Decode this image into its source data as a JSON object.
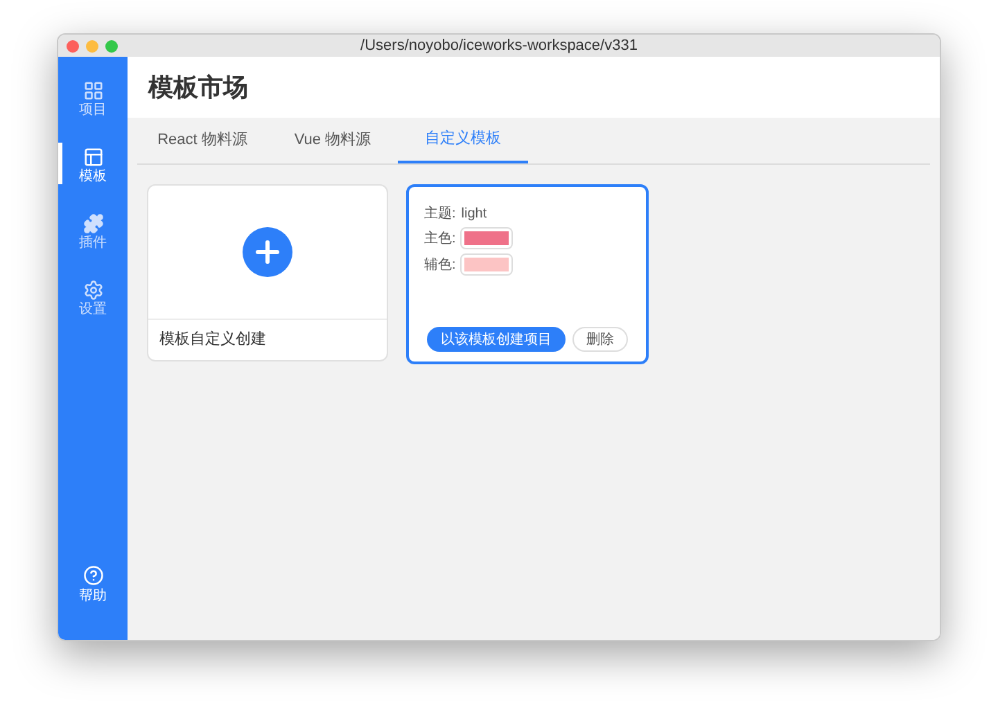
{
  "window": {
    "title": "/Users/noyobo/iceworks-workspace/v331"
  },
  "sidebar": {
    "items": [
      {
        "label": "项目",
        "selected": false
      },
      {
        "label": "模板",
        "selected": true
      },
      {
        "label": "插件",
        "selected": false
      },
      {
        "label": "设置",
        "selected": false
      }
    ],
    "help": {
      "label": "帮助"
    }
  },
  "page_title": "模板市场",
  "tabs": [
    {
      "label": "React 物料源",
      "selected": false
    },
    {
      "label": "Vue 物料源",
      "selected": false
    },
    {
      "label": "自定义模板",
      "selected": true
    }
  ],
  "create_card": {
    "label": "模板自定义创建"
  },
  "templates": [
    {
      "theme_label": "主题:",
      "theme": "light",
      "swatches": [
        {
          "label": "主色:",
          "color": "#ef7189"
        },
        {
          "label": "辅色:",
          "color": "#fcc4c4"
        }
      ],
      "create_button": "以该模板创建项目",
      "delete_button": "删除",
      "selected": true
    }
  ]
}
